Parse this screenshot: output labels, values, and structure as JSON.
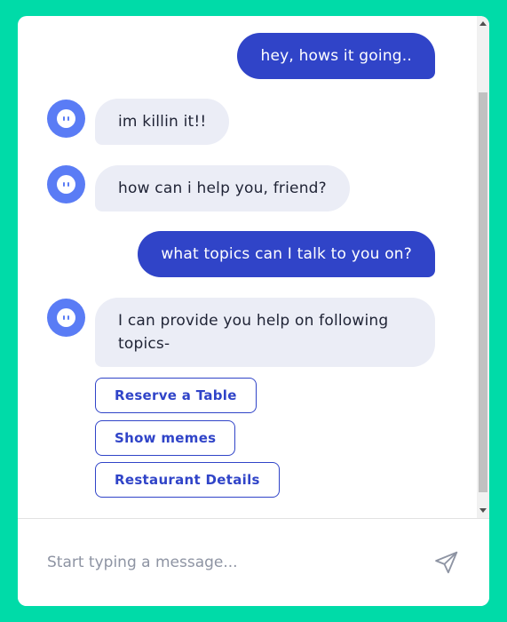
{
  "colors": {
    "page_background": "#00dba8",
    "user_bubble": "#3044c8",
    "bot_bubble": "#ebedf6",
    "avatar": "#5a7cf5",
    "accent": "#3044c8"
  },
  "messages": [
    {
      "sender": "user",
      "text": "hey, hows it going.."
    },
    {
      "sender": "bot",
      "text": "im killin it!!",
      "icon": "bot-avatar-icon"
    },
    {
      "sender": "bot",
      "text": "how can i help you, friend?",
      "icon": "bot-avatar-icon"
    },
    {
      "sender": "user",
      "text": "what topics can I talk to you on?"
    },
    {
      "sender": "bot",
      "text": "I can provide you help on following topics-",
      "icon": "bot-avatar-icon"
    }
  ],
  "quick_replies": [
    {
      "label": "Reserve a Table"
    },
    {
      "label": "Show memes"
    },
    {
      "label": "Restaurant Details"
    }
  ],
  "composer": {
    "placeholder": "Start typing a message...",
    "value": "",
    "send_icon": "send-icon"
  }
}
